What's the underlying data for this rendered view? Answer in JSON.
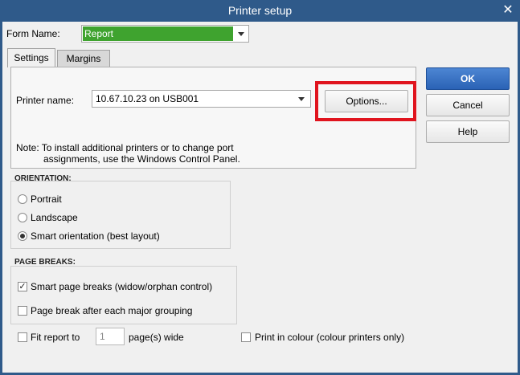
{
  "window": {
    "title": "Printer setup"
  },
  "form": {
    "label": "Form Name:",
    "value": "Report"
  },
  "tabs": [
    {
      "label": "Settings",
      "active": true
    },
    {
      "label": "Margins",
      "active": false
    }
  ],
  "printer": {
    "label": "Printer name:",
    "value": "10.67.10.23 on USB001"
  },
  "buttons": {
    "options": "Options...",
    "ok": "OK",
    "cancel": "Cancel",
    "help": "Help"
  },
  "note": {
    "line1": "Note: To install additional printers or to change port",
    "line2": "assignments, use the Windows Control Panel."
  },
  "orientation": {
    "title": "ORIENTATION:",
    "options": [
      {
        "label": "Portrait",
        "selected": false
      },
      {
        "label": "Landscape",
        "selected": false
      },
      {
        "label": "Smart orientation (best layout)",
        "selected": true
      }
    ]
  },
  "page_breaks": {
    "title": "PAGE BREAKS:",
    "smart": {
      "label": "Smart page breaks (widow/orphan control)",
      "checked": true
    },
    "major": {
      "label": "Page break after each major grouping",
      "checked": false
    }
  },
  "fit": {
    "label": "Fit report to",
    "value": "1",
    "suffix": "page(s) wide",
    "checked": false
  },
  "colour": {
    "label": "Print in colour (colour printers only)",
    "checked": false
  },
  "colors": {
    "accent": "#2f5a8a",
    "highlight": "#e0141e",
    "form_value_bg": "#3fa32f"
  },
  "icons": {
    "close": "close-icon",
    "dropdown": "chevron-down-icon",
    "check": "checkmark-icon"
  }
}
